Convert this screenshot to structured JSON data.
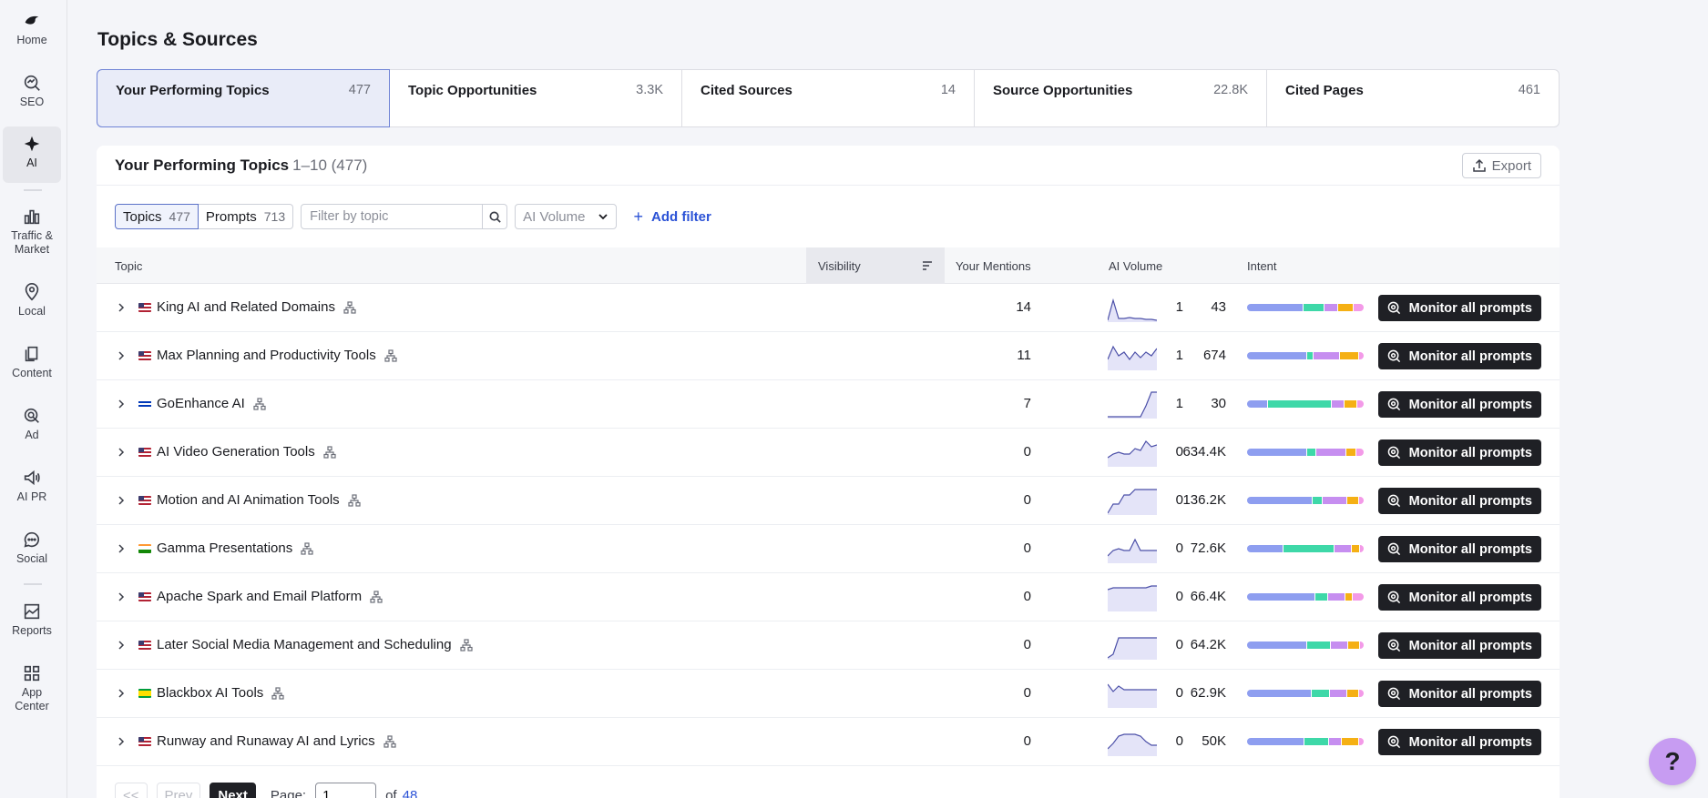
{
  "sidebar": {
    "items": [
      {
        "label": "Home",
        "icon": "brand-logo-icon"
      },
      {
        "label": "SEO",
        "icon": "seo-icon"
      },
      {
        "label": "AI",
        "icon": "ai-icon"
      },
      {
        "label": "Traffic &\nMarket",
        "icon": "traffic-market-icon"
      },
      {
        "label": "Local",
        "icon": "local-pin-icon"
      },
      {
        "label": "Content",
        "icon": "content-icon"
      },
      {
        "label": "Ad",
        "icon": "ad-target-icon"
      },
      {
        "label": "AI PR",
        "icon": "ai-pr-megaphone-icon"
      },
      {
        "label": "Social",
        "icon": "social-chat-icon"
      },
      {
        "label": "Reports",
        "icon": "reports-chart-icon"
      },
      {
        "label": "App\nCenter",
        "icon": "app-grid-icon"
      }
    ]
  },
  "page": {
    "title": "Topics & Sources"
  },
  "tabs": [
    {
      "label": "Your Performing Topics",
      "count": "477"
    },
    {
      "label": "Topic Opportunities",
      "count": "3.3K"
    },
    {
      "label": "Cited Sources",
      "count": "14"
    },
    {
      "label": "Source Opportunities",
      "count": "22.8K"
    },
    {
      "label": "Cited Pages",
      "count": "461"
    }
  ],
  "card": {
    "title": "Your Performing Topics",
    "range": "1–10 (477)",
    "export_label": "Export"
  },
  "filters": {
    "topics_label": "Topics",
    "topics_count": "477",
    "prompts_label": "Prompts",
    "prompts_count": "713",
    "search_placeholder": "Filter by topic",
    "volume_dropdown": "AI Volume",
    "add_filter": "Add filter"
  },
  "table": {
    "columns": {
      "topic": "Topic",
      "visibility": "Visibility",
      "mentions": "Your Mentions",
      "volume": "AI Volume",
      "intent": "Intent"
    },
    "action_label": "Monitor all prompts",
    "intent_colors": [
      "#8e9ef0",
      "#3ed8a8",
      "#c68ef0",
      "#f5b014",
      "#f39ae8"
    ],
    "rows": [
      {
        "topic": "King AI and Related Domains",
        "flag": "us",
        "visibility": "14",
        "mentions": "1",
        "volume": "43",
        "intent": [
          45,
          16,
          10,
          12,
          8
        ],
        "trend": [
          30,
          8,
          28,
          28,
          27,
          28,
          28,
          29,
          29,
          30
        ]
      },
      {
        "topic": "Max Planning and Productivity Tools",
        "flag": "us",
        "visibility": "11",
        "mentions": "1",
        "volume": "674",
        "intent": [
          50,
          5,
          22,
          15,
          4
        ],
        "trend": [
          20,
          6,
          16,
          12,
          20,
          12,
          18,
          12,
          16,
          8
        ]
      },
      {
        "topic": "GoEnhance AI",
        "flag": "il",
        "visibility": "7",
        "mentions": "1",
        "volume": "30",
        "intent": [
          17,
          53,
          10,
          10,
          5
        ],
        "trend": [
          30,
          30,
          30,
          30,
          30,
          30,
          30,
          18,
          3,
          3
        ]
      },
      {
        "topic": "AI Video Generation Tools",
        "flag": "us",
        "visibility": "0",
        "mentions": "0",
        "volume": "634.4K",
        "intent": [
          50,
          7,
          25,
          8,
          6
        ],
        "trend": [
          22,
          18,
          16,
          18,
          18,
          12,
          14,
          4,
          10,
          8
        ]
      },
      {
        "topic": "Motion and AI Animation Tools",
        "flag": "us",
        "visibility": "0",
        "mentions": "0",
        "volume": "136.2K",
        "intent": [
          55,
          8,
          20,
          9,
          4
        ],
        "trend": [
          30,
          20,
          20,
          10,
          10,
          4,
          4,
          4,
          4,
          4
        ]
      },
      {
        "topic": "Gamma Presentations",
        "flag": "in",
        "visibility": "0",
        "mentions": "0",
        "volume": "72.6K",
        "intent": [
          30,
          43,
          14,
          6,
          3
        ],
        "trend": [
          24,
          18,
          16,
          18,
          18,
          6,
          18,
          18,
          18,
          18
        ]
      },
      {
        "topic": "Apache Spark and Email Platform",
        "flag": "us",
        "visibility": "0",
        "mentions": "0",
        "volume": "66.4K",
        "intent": [
          57,
          10,
          14,
          6,
          9
        ],
        "trend": [
          8,
          6,
          6,
          6,
          6,
          6,
          6,
          6,
          4,
          4
        ]
      },
      {
        "topic": "Later Social Media Management and Scheduling",
        "flag": "us",
        "visibility": "0",
        "mentions": "0",
        "volume": "64.2K",
        "intent": [
          50,
          20,
          14,
          9,
          3
        ],
        "trend": [
          30,
          26,
          8,
          8,
          8,
          8,
          8,
          8,
          8,
          8
        ]
      },
      {
        "topic": "Blackbox AI Tools",
        "flag": "br",
        "visibility": "0",
        "mentions": "0",
        "volume": "62.9K",
        "intent": [
          54,
          15,
          14,
          9,
          4
        ],
        "trend": [
          6,
          14,
          8,
          12,
          12,
          12,
          12,
          12,
          12,
          12
        ]
      },
      {
        "topic": "Runway and Runaway AI and Lyrics",
        "flag": "us",
        "visibility": "0",
        "mentions": "0",
        "volume": "50K",
        "intent": [
          48,
          20,
          10,
          14,
          4
        ],
        "trend": [
          24,
          18,
          10,
          8,
          8,
          8,
          10,
          16,
          20,
          20
        ]
      }
    ]
  },
  "pager": {
    "first": "<<",
    "prev": "Prev",
    "next": "Next",
    "page_label": "Page:",
    "page_value": "1",
    "of_label": "of",
    "total_pages": "48"
  },
  "help": {
    "label": "?"
  }
}
